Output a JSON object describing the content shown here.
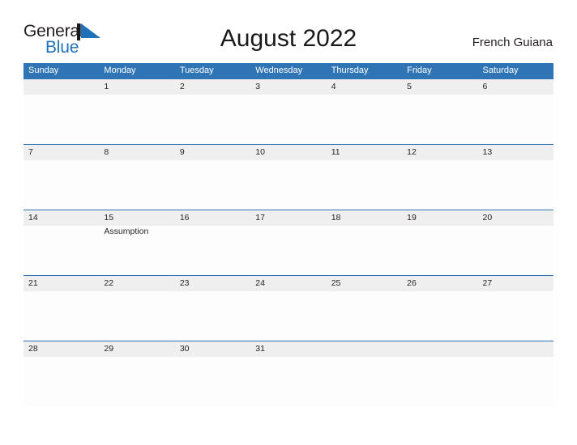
{
  "brand": {
    "name_part1": "General",
    "name_part2": "Blue",
    "mark_icon": "triangle-flag-icon",
    "color_primary": "#1f71b8",
    "color_text": "#231f20"
  },
  "header": {
    "title": "August 2022",
    "location": "French Guiana"
  },
  "calendar": {
    "accent_color": "#2f75b5",
    "band_color": "#efefef",
    "weekday_headers": [
      "Sunday",
      "Monday",
      "Tuesday",
      "Wednesday",
      "Thursday",
      "Friday",
      "Saturday"
    ],
    "weeks": [
      {
        "days": [
          {
            "num": "",
            "events": []
          },
          {
            "num": "1",
            "events": []
          },
          {
            "num": "2",
            "events": []
          },
          {
            "num": "3",
            "events": []
          },
          {
            "num": "4",
            "events": []
          },
          {
            "num": "5",
            "events": []
          },
          {
            "num": "6",
            "events": []
          }
        ]
      },
      {
        "days": [
          {
            "num": "7",
            "events": []
          },
          {
            "num": "8",
            "events": []
          },
          {
            "num": "9",
            "events": []
          },
          {
            "num": "10",
            "events": []
          },
          {
            "num": "11",
            "events": []
          },
          {
            "num": "12",
            "events": []
          },
          {
            "num": "13",
            "events": []
          }
        ]
      },
      {
        "days": [
          {
            "num": "14",
            "events": []
          },
          {
            "num": "15",
            "events": [
              "Assumption"
            ]
          },
          {
            "num": "16",
            "events": []
          },
          {
            "num": "17",
            "events": []
          },
          {
            "num": "18",
            "events": []
          },
          {
            "num": "19",
            "events": []
          },
          {
            "num": "20",
            "events": []
          }
        ]
      },
      {
        "days": [
          {
            "num": "21",
            "events": []
          },
          {
            "num": "22",
            "events": []
          },
          {
            "num": "23",
            "events": []
          },
          {
            "num": "24",
            "events": []
          },
          {
            "num": "25",
            "events": []
          },
          {
            "num": "26",
            "events": []
          },
          {
            "num": "27",
            "events": []
          }
        ]
      },
      {
        "days": [
          {
            "num": "28",
            "events": []
          },
          {
            "num": "29",
            "events": []
          },
          {
            "num": "30",
            "events": []
          },
          {
            "num": "31",
            "events": []
          },
          {
            "num": "",
            "events": []
          },
          {
            "num": "",
            "events": []
          },
          {
            "num": "",
            "events": []
          }
        ]
      }
    ]
  }
}
